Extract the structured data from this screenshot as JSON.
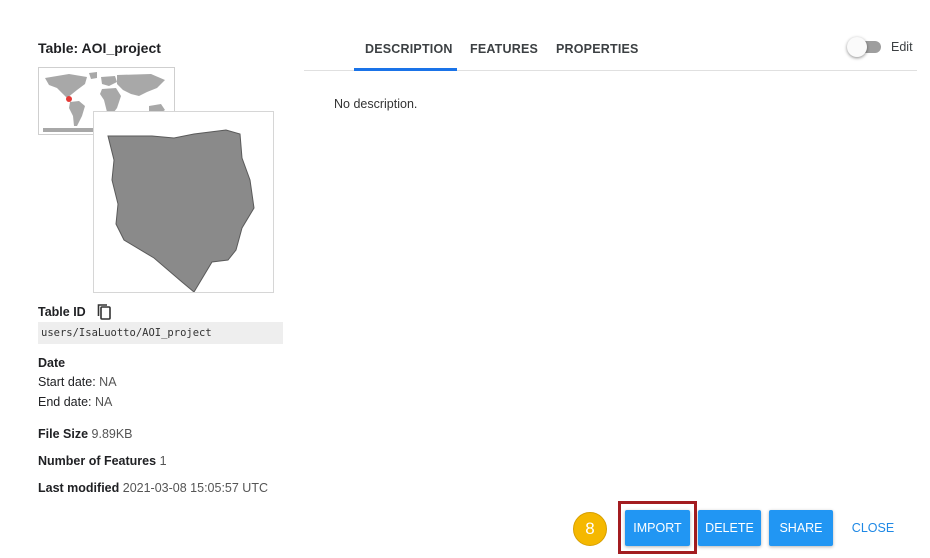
{
  "dialog": {
    "title": "Table: AOI_project",
    "tabs": [
      {
        "label": "DESCRIPTION",
        "active": true
      },
      {
        "label": "FEATURES",
        "active": false
      },
      {
        "label": "PROPERTIES",
        "active": false
      }
    ],
    "description_text": "No description.",
    "edit_toggle": {
      "label": "Edit",
      "on": false
    }
  },
  "info": {
    "table_id_label": "Table ID",
    "table_id_value": "users/IsaLuotto/AOI_project",
    "date_label": "Date",
    "start_date_label": "Start date:",
    "start_date_value": "NA",
    "end_date_label": "End date:",
    "end_date_value": "NA",
    "file_size_label": "File Size",
    "file_size_value": "9.89KB",
    "num_features_label": "Number of Features",
    "num_features_value": "1",
    "last_modified_label": "Last modified",
    "last_modified_value": "2021-03-08 15:05:57 UTC"
  },
  "actions": {
    "step_badge": "8",
    "import_label": "IMPORT",
    "delete_label": "DELETE",
    "share_label": "SHARE",
    "close_label": "CLOSE"
  },
  "colors": {
    "primary_button": "#2196f3",
    "active_tab_indicator": "#1a73e8",
    "highlight_box": "#a31c20",
    "step_badge": "#f5b800",
    "polygon_fill": "#8a8a8a",
    "world_marker": "#e53935"
  },
  "icons": {
    "copy": "copy-icon"
  }
}
